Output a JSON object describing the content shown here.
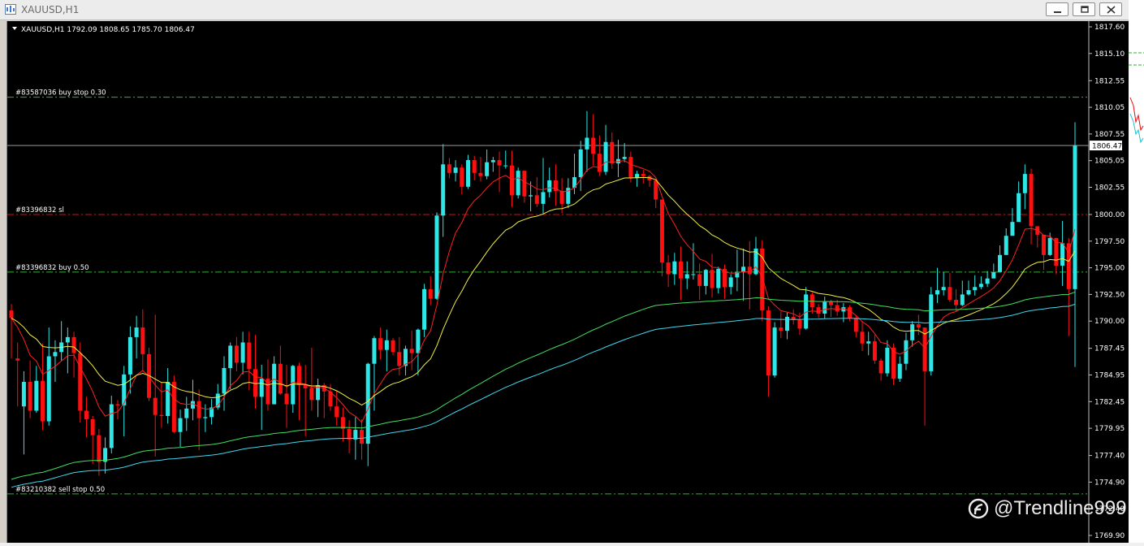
{
  "window": {
    "title": "XAUUSD,H1",
    "buttons": [
      "minimize",
      "restore",
      "close"
    ]
  },
  "chart_header": "XAUUSD,H1  1792.09 1808.65 1785.70 1806.47",
  "order_lines": [
    {
      "label": "#83587036 buy stop 0.30",
      "price": 1811.0,
      "color": "#2fb52f",
      "style": "dashdot"
    },
    {
      "label": "#83396832 sl",
      "price": 1800.0,
      "color": "#d01010",
      "style": "dashdot"
    },
    {
      "label": "#83396832 buy 0.50",
      "price": 1794.6,
      "color": "#2fb52f",
      "style": "dashdot"
    },
    {
      "label": "#83210382 sell stop 0.50",
      "price": 1773.8,
      "color": "#2fb52f",
      "style": "dashdot"
    }
  ],
  "current_price": {
    "value": 1806.47,
    "label": "1806.47"
  },
  "watermark": "@Trendline999",
  "colors": {
    "bull": "#2ee6e6",
    "bear": "#ff1010",
    "ma_red": "#ff2020",
    "ma_yellow": "#f0f040",
    "ma_green": "#40e060",
    "ma_cyan": "#40d8f0",
    "grid_label": "#ffffff"
  },
  "chart_data": {
    "type": "candlestick",
    "title": "XAUUSD,H1",
    "ylim": [
      1769.9,
      1817.6
    ],
    "yticks": [
      "1817.60",
      "1815.10",
      "1812.55",
      "1810.05",
      "1807.55",
      "1805.05",
      "1802.55",
      "1800.00",
      "1797.50",
      "1795.00",
      "1792.50",
      "1790.00",
      "1787.45",
      "1784.95",
      "1782.45",
      "1779.95",
      "1777.40",
      "1774.90",
      "1772.40",
      "1769.90"
    ],
    "candles": [
      [
        1791.0,
        1790.3,
        1786.5,
        1791.6
      ],
      [
        1786.5,
        1786.3,
        1782.0,
        1788.0
      ],
      [
        1782.0,
        1784.3,
        1777.5,
        1785.3
      ],
      [
        1784.3,
        1781.6,
        1780.9,
        1786.3
      ],
      [
        1781.6,
        1784.4,
        1781.4,
        1785.8
      ],
      [
        1784.4,
        1780.6,
        1779.8,
        1787.9
      ],
      [
        1780.6,
        1786.7,
        1780.2,
        1789.4
      ],
      [
        1786.7,
        1787.1,
        1784.3,
        1788.2
      ],
      [
        1787.1,
        1788.0,
        1786.3,
        1790.0
      ],
      [
        1788.0,
        1788.5,
        1785.1,
        1789.4
      ],
      [
        1788.5,
        1787.0,
        1784.7,
        1789.0
      ],
      [
        1787.0,
        1781.6,
        1780.5,
        1788.0
      ],
      [
        1781.6,
        1780.8,
        1779.1,
        1782.9
      ],
      [
        1780.8,
        1779.3,
        1776.6,
        1781.1
      ],
      [
        1779.3,
        1776.8,
        1775.5,
        1779.9
      ],
      [
        1776.8,
        1778.1,
        1775.7,
        1779.1
      ],
      [
        1778.1,
        1782.2,
        1777.6,
        1783.0
      ],
      [
        1782.2,
        1782.1,
        1780.8,
        1782.6
      ],
      [
        1782.1,
        1785.0,
        1779.2,
        1785.8
      ],
      [
        1785.0,
        1788.5,
        1783.2,
        1789.5
      ],
      [
        1788.5,
        1789.4,
        1786.5,
        1790.5
      ],
      [
        1789.4,
        1786.9,
        1785.4,
        1791.1
      ],
      [
        1786.9,
        1782.8,
        1782.5,
        1787.5
      ],
      [
        1782.8,
        1781.2,
        1777.3,
        1790.6
      ],
      [
        1781.2,
        1781.1,
        1780.0,
        1784.3
      ],
      [
        1781.1,
        1784.3,
        1780.4,
        1785.6
      ],
      [
        1784.3,
        1779.6,
        1779.5,
        1784.9
      ],
      [
        1779.6,
        1780.9,
        1778.2,
        1781.7
      ],
      [
        1780.9,
        1781.8,
        1779.7,
        1782.9
      ],
      [
        1781.8,
        1782.5,
        1780.7,
        1784.5
      ],
      [
        1782.5,
        1780.9,
        1777.9,
        1783.6
      ],
      [
        1780.9,
        1781.0,
        1779.6,
        1782.2
      ],
      [
        1781.0,
        1781.9,
        1780.3,
        1782.7
      ],
      [
        1781.9,
        1783.2,
        1781.7,
        1784.1
      ],
      [
        1783.2,
        1785.6,
        1781.6,
        1786.7
      ],
      [
        1785.6,
        1787.7,
        1783.6,
        1788.0
      ],
      [
        1787.7,
        1786.1,
        1785.3,
        1788.5
      ],
      [
        1786.1,
        1788.0,
        1785.0,
        1789.0
      ],
      [
        1788.0,
        1785.5,
        1783.5,
        1789.0
      ],
      [
        1785.5,
        1782.9,
        1781.8,
        1788.7
      ],
      [
        1782.9,
        1784.6,
        1779.8,
        1785.9
      ],
      [
        1784.6,
        1782.2,
        1781.6,
        1786.4
      ],
      [
        1782.2,
        1786.0,
        1782.2,
        1786.7
      ],
      [
        1786.0,
        1783.2,
        1783.1,
        1787.7
      ],
      [
        1783.2,
        1782.2,
        1780.0,
        1785.9
      ],
      [
        1782.2,
        1785.8,
        1781.4,
        1785.9
      ],
      [
        1785.8,
        1784.0,
        1780.7,
        1786.1
      ],
      [
        1784.0,
        1783.7,
        1779.2,
        1785.9
      ],
      [
        1783.7,
        1782.6,
        1781.6,
        1787.5
      ],
      [
        1782.6,
        1784.0,
        1781.0,
        1784.6
      ],
      [
        1784.0,
        1783.4,
        1780.9,
        1784.2
      ],
      [
        1783.4,
        1782.0,
        1781.6,
        1784.1
      ],
      [
        1782.0,
        1781.0,
        1780.2,
        1783.5
      ],
      [
        1781.0,
        1779.9,
        1778.7,
        1781.9
      ],
      [
        1779.9,
        1778.9,
        1777.6,
        1780.7
      ],
      [
        1778.9,
        1779.8,
        1777.0,
        1781.0
      ],
      [
        1779.8,
        1778.5,
        1777.0,
        1780.8
      ],
      [
        1778.5,
        1786.0,
        1776.4,
        1786.1
      ],
      [
        1786.0,
        1788.4,
        1781.6,
        1788.6
      ],
      [
        1788.4,
        1787.3,
        1786.4,
        1789.4
      ],
      [
        1787.3,
        1788.2,
        1785.3,
        1789.2
      ],
      [
        1788.2,
        1787.1,
        1786.8,
        1788.4
      ],
      [
        1787.1,
        1785.8,
        1784.9,
        1788.5
      ],
      [
        1785.8,
        1787.4,
        1784.9,
        1787.7
      ],
      [
        1787.4,
        1787.0,
        1785.4,
        1789.1
      ],
      [
        1787.0,
        1789.2,
        1784.9,
        1789.3
      ],
      [
        1789.2,
        1793.0,
        1788.5,
        1793.5
      ],
      [
        1793.0,
        1792.1,
        1791.5,
        1794.2
      ],
      [
        1792.1,
        1799.9,
        1792.0,
        1800.2
      ],
      [
        1799.9,
        1804.7,
        1797.9,
        1806.6
      ],
      [
        1804.7,
        1803.9,
        1803.4,
        1805.3
      ],
      [
        1803.9,
        1804.4,
        1803.1,
        1805.1
      ],
      [
        1804.4,
        1802.6,
        1801.9,
        1804.7
      ],
      [
        1802.6,
        1805.1,
        1802.4,
        1805.6
      ],
      [
        1805.1,
        1803.9,
        1803.2,
        1805.5
      ],
      [
        1803.9,
        1803.6,
        1803.1,
        1805.4
      ],
      [
        1803.6,
        1804.9,
        1803.3,
        1806.1
      ],
      [
        1804.9,
        1805.1,
        1804.0,
        1805.4
      ],
      [
        1805.1,
        1804.6,
        1802.1,
        1805.9
      ],
      [
        1804.6,
        1804.6,
        1804.3,
        1806.0
      ],
      [
        1804.6,
        1801.8,
        1800.7,
        1806.0
      ],
      [
        1801.8,
        1804.1,
        1801.5,
        1804.4
      ],
      [
        1804.1,
        1801.7,
        1801.1,
        1802.5
      ],
      [
        1801.7,
        1801.8,
        1800.3,
        1803.1
      ],
      [
        1801.8,
        1801.0,
        1800.7,
        1803.5
      ],
      [
        1801.0,
        1802.1,
        1800.1,
        1805.3
      ],
      [
        1802.1,
        1803.2,
        1801.6,
        1804.4
      ],
      [
        1803.2,
        1802.2,
        1800.8,
        1804.7
      ],
      [
        1802.2,
        1801.0,
        1800.1,
        1803.4
      ],
      [
        1801.0,
        1802.5,
        1800.6,
        1803.4
      ],
      [
        1802.5,
        1803.5,
        1801.9,
        1805.7
      ],
      [
        1803.5,
        1806.1,
        1802.2,
        1806.9
      ],
      [
        1806.1,
        1807.2,
        1804.0,
        1809.7
      ],
      [
        1807.2,
        1805.7,
        1804.6,
        1809.4
      ],
      [
        1805.7,
        1804.0,
        1803.6,
        1807.4
      ],
      [
        1804.0,
        1806.8,
        1803.7,
        1808.4
      ],
      [
        1806.8,
        1804.8,
        1804.3,
        1807.7
      ],
      [
        1804.8,
        1805.2,
        1803.5,
        1807.0
      ],
      [
        1805.2,
        1805.4,
        1804.9,
        1806.7
      ],
      [
        1805.4,
        1803.4,
        1803.0,
        1805.9
      ],
      [
        1803.4,
        1803.8,
        1802.6,
        1804.1
      ],
      [
        1803.8,
        1803.6,
        1802.9,
        1804.2
      ],
      [
        1803.6,
        1803.2,
        1802.6,
        1803.7
      ],
      [
        1803.2,
        1801.4,
        1800.6,
        1803.3
      ],
      [
        1801.4,
        1795.5,
        1794.2,
        1801.4
      ],
      [
        1795.5,
        1794.4,
        1793.2,
        1796.2
      ],
      [
        1794.4,
        1795.6,
        1793.4,
        1796.4
      ],
      [
        1795.6,
        1794.0,
        1792.0,
        1797.0
      ],
      [
        1794.0,
        1794.4,
        1793.0,
        1795.6
      ],
      [
        1794.4,
        1794.4,
        1793.9,
        1797.3
      ],
      [
        1794.4,
        1793.3,
        1792.0,
        1795.4
      ],
      [
        1793.3,
        1794.8,
        1792.5,
        1794.9
      ],
      [
        1794.8,
        1793.1,
        1792.2,
        1796.3
      ],
      [
        1793.1,
        1794.9,
        1792.6,
        1795.1
      ],
      [
        1794.9,
        1793.2,
        1792.1,
        1795.3
      ],
      [
        1793.2,
        1794.1,
        1792.5,
        1794.4
      ],
      [
        1794.1,
        1794.6,
        1792.8,
        1796.7
      ],
      [
        1794.6,
        1795.1,
        1791.9,
        1796.8
      ],
      [
        1795.1,
        1794.4,
        1791.1,
        1797.5
      ],
      [
        1794.4,
        1796.8,
        1794.3,
        1797.9
      ],
      [
        1796.8,
        1791.0,
        1790.0,
        1797.6
      ],
      [
        1791.0,
        1784.9,
        1782.9,
        1791.4
      ],
      [
        1784.9,
        1789.4,
        1784.7,
        1789.9
      ],
      [
        1789.4,
        1789.1,
        1788.4,
        1790.9
      ],
      [
        1789.1,
        1790.4,
        1788.3,
        1790.8
      ],
      [
        1790.4,
        1790.1,
        1789.7,
        1791.1
      ],
      [
        1790.1,
        1789.3,
        1788.7,
        1790.8
      ],
      [
        1789.3,
        1792.5,
        1789.2,
        1793.2
      ],
      [
        1792.5,
        1791.3,
        1790.7,
        1792.7
      ],
      [
        1791.3,
        1790.7,
        1790.3,
        1791.6
      ],
      [
        1790.7,
        1791.8,
        1790.2,
        1792.3
      ],
      [
        1791.8,
        1791.5,
        1790.4,
        1792.0
      ],
      [
        1791.5,
        1790.9,
        1790.5,
        1792.0
      ],
      [
        1790.9,
        1791.3,
        1789.9,
        1791.7
      ],
      [
        1791.3,
        1790.3,
        1790.0,
        1791.5
      ],
      [
        1790.3,
        1789.0,
        1788.5,
        1790.5
      ],
      [
        1789.0,
        1787.9,
        1787.2,
        1790.0
      ],
      [
        1787.9,
        1788.1,
        1786.8,
        1789.0
      ],
      [
        1788.1,
        1786.3,
        1786.0,
        1788.7
      ],
      [
        1786.3,
        1785.1,
        1784.4,
        1786.5
      ],
      [
        1785.1,
        1787.5,
        1784.8,
        1788.2
      ],
      [
        1787.5,
        1784.6,
        1784.0,
        1787.9
      ],
      [
        1784.6,
        1786.0,
        1784.3,
        1786.7
      ],
      [
        1786.0,
        1788.2,
        1785.4,
        1788.9
      ],
      [
        1788.2,
        1789.7,
        1787.6,
        1790.0
      ],
      [
        1789.7,
        1789.4,
        1788.7,
        1790.6
      ],
      [
        1789.4,
        1785.3,
        1780.2,
        1789.4
      ],
      [
        1785.3,
        1792.5,
        1784.9,
        1793.2
      ],
      [
        1792.5,
        1792.9,
        1791.7,
        1795.0
      ],
      [
        1792.9,
        1793.2,
        1792.4,
        1794.6
      ],
      [
        1793.2,
        1792.0,
        1791.8,
        1794.5
      ],
      [
        1792.0,
        1791.5,
        1790.9,
        1793.0
      ],
      [
        1791.5,
        1792.5,
        1791.4,
        1793.8
      ],
      [
        1792.5,
        1792.9,
        1792.4,
        1793.8
      ],
      [
        1792.9,
        1793.2,
        1792.4,
        1794.3
      ],
      [
        1793.2,
        1793.5,
        1793.0,
        1794.2
      ],
      [
        1793.5,
        1794.0,
        1793.2,
        1794.7
      ],
      [
        1794.0,
        1794.6,
        1794.1,
        1795.4
      ],
      [
        1794.6,
        1796.2,
        1795.2,
        1797.1
      ],
      [
        1796.2,
        1798.0,
        1796.9,
        1798.7
      ],
      [
        1798.0,
        1799.3,
        1798.2,
        1800.6
      ],
      [
        1799.3,
        1802.0,
        1799.8,
        1803.1
      ],
      [
        1802.0,
        1803.8,
        1800.5,
        1804.7
      ],
      [
        1803.8,
        1798.9,
        1797.2,
        1804.3
      ],
      [
        1798.9,
        1798.1,
        1796.9,
        1798.8
      ],
      [
        1798.1,
        1796.2,
        1794.8,
        1797.7
      ],
      [
        1796.2,
        1797.8,
        1796.1,
        1798.3
      ],
      [
        1797.8,
        1795.2,
        1794.4,
        1797.7
      ],
      [
        1795.2,
        1797.3,
        1793.3,
        1799.4
      ],
      [
        1797.3,
        1793.0,
        1788.6,
        1797.8
      ],
      [
        1793.0,
        1806.47,
        1785.7,
        1808.65
      ]
    ],
    "moving_averages": [
      {
        "color": "#ff2020",
        "period_label": "fast"
      },
      {
        "color": "#f0f040",
        "period_label": "slow"
      },
      {
        "color": "#40e060",
        "period_label": "long"
      },
      {
        "color": "#40d8f0",
        "period_label": "long2"
      }
    ]
  }
}
